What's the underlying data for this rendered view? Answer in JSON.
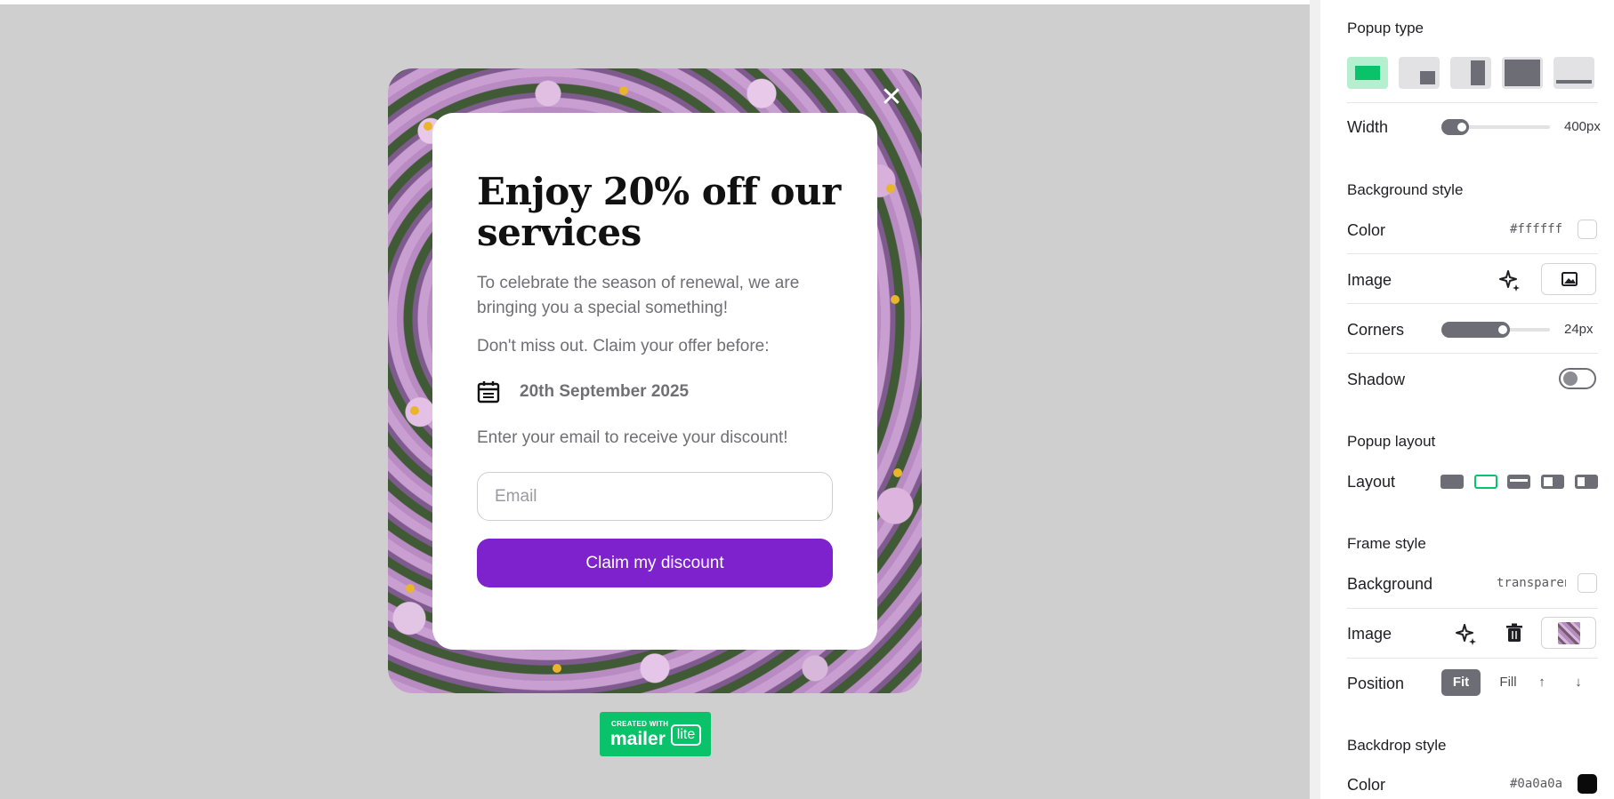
{
  "popup": {
    "close_glyph": "✕",
    "title": "Enjoy 20% off our services",
    "description": "To celebrate the season of renewal, we are bringing you a special something!",
    "claim_before": "Don't miss out. Claim your offer before:",
    "date": "20th September 2025",
    "email_prompt": "Enter your email to receive your discount!",
    "email_placeholder": "Email",
    "email_value": "",
    "button_label": "Claim my discount",
    "button_color": "#7e22ce"
  },
  "badge": {
    "created_with": "CREATED WITH",
    "brand_main": "mailer",
    "brand_tag": "lite",
    "color": "#09c269"
  },
  "panel": {
    "popup_type": {
      "title": "Popup type",
      "options": [
        "centered-popup",
        "corner-popup",
        "side-popup",
        "fullscreen-popup",
        "bar-popup"
      ],
      "selected_index": 0
    },
    "width": {
      "label": "Width",
      "value": "400px",
      "fill": 0.17
    },
    "background_style": {
      "title": "Background style",
      "color_label": "Color",
      "color_value": "#ffffff",
      "image_label": "Image",
      "corners_label": "Corners",
      "corners_value": "24px",
      "corners_fill": 0.55,
      "shadow_label": "Shadow",
      "shadow_on": false
    },
    "popup_layout": {
      "title": "Popup layout",
      "layout_label": "Layout",
      "options": [
        "layout-full",
        "layout-outline",
        "layout-banner",
        "layout-left-image",
        "layout-right-image"
      ],
      "selected_index": 1
    },
    "frame_style": {
      "title": "Frame style",
      "background_label": "Background",
      "background_value": "transparent",
      "image_label": "Image",
      "position_label": "Position",
      "position_fit": "Fit",
      "position_fill": "Fill",
      "up_glyph": "↑",
      "down_glyph": "↓"
    },
    "backdrop_style": {
      "title": "Backdrop style",
      "color_label": "Color",
      "color_value": "#0a0a0a"
    }
  },
  "colors": {
    "accent_green": "#09c269",
    "selected_bg": "#b6efcf",
    "icon_gray": "#6d6d75",
    "canvas_bg": "#cfcfcf"
  }
}
